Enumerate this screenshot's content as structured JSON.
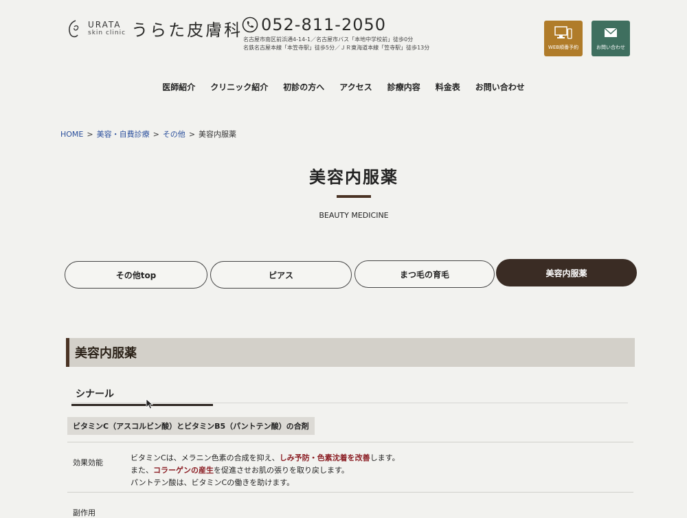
{
  "header": {
    "logo_en_line1": "URATA",
    "logo_en_line2": "skin clinic",
    "logo_jp": "うらた皮膚科",
    "phone": "052-811-2050",
    "address_line1": "名古屋市南区前浜通4-14-1／名古屋市バス「本地中学校前」徒歩0分",
    "address_line2": "名鉄名古屋本線「本笠寺駅」徒歩5分／ＪＲ東海道本線「笠寺駅」徒歩13分",
    "web_button_label": "WEB順番予約",
    "contact_button_label": "お問い合わせ",
    "web_button_color": "#b07c2a",
    "contact_button_color": "#3f6f5f",
    "web_button_icon": "computer-icon",
    "contact_button_icon": "mail-icon"
  },
  "nav": {
    "items": [
      "医師紹介",
      "クリニック紹介",
      "初診の方へ",
      "アクセス",
      "診療内容",
      "料金表",
      "お問い合わせ"
    ]
  },
  "breadcrumb": {
    "home": "HOME",
    "level1": "美容・自費診療",
    "level2": "その他",
    "current": "美容内服薬",
    "separator": ">"
  },
  "page": {
    "title": "美容内服薬",
    "subtitle": "BEAUTY MEDICINE"
  },
  "tabs": [
    {
      "label": "その他top",
      "active": false
    },
    {
      "label": "ピアス",
      "active": false
    },
    {
      "label": "まつ毛の育毛",
      "active": false
    },
    {
      "label": "美容内服薬",
      "active": true
    }
  ],
  "section": {
    "heading": "美容内服薬",
    "product_name": "シナール",
    "description": "ビタミンC（アスコルビン酸）とビタミンB5（パントテン酸）の合剤",
    "effect_label": "効果効能",
    "effect_lines": [
      {
        "pre": "ビタミンCは、メラニン色素の合成を抑え、",
        "hl": "しみ予防・色素沈着を改善",
        "post": "します。"
      },
      {
        "pre": "また、",
        "hl": "コラーゲンの産生",
        "post": "を促進させお肌の張りを取り戻します。"
      },
      {
        "pre": "パントテン酸は、ビタミンCの働きを助けます。",
        "hl": "",
        "post": ""
      }
    ],
    "side_effect_label": "副作用"
  },
  "colors": {
    "accent_brown": "#4a3324",
    "highlight_red": "#8b1e24",
    "link_blue": "#2a4f9c"
  }
}
